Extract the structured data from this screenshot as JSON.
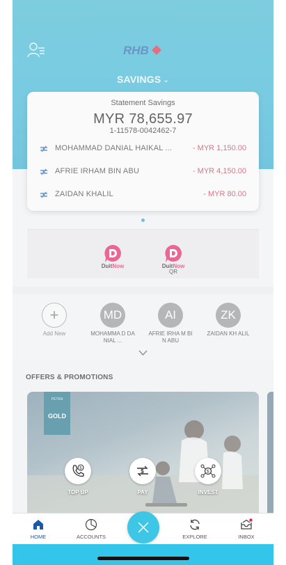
{
  "header": {
    "logo_text": "RHB",
    "account_switch_label": "SAVINGS"
  },
  "account_card": {
    "type": "Statement Savings",
    "balance": "MYR 78,655.97",
    "number": "1-11578-0042462-7",
    "transactions": [
      {
        "name": "MOHAMMAD DANIAL HAIKAL ...",
        "amount": "- MYR 1,150.00"
      },
      {
        "name": "AFRIE IRHAM BIN ABU",
        "amount": "- MYR 4,150.00"
      },
      {
        "name": "ZAIDAN KHALIL",
        "amount": "- MYR 80.00"
      }
    ]
  },
  "duitnow": {
    "items": [
      {
        "brand_a": "Duit",
        "brand_b": "Now",
        "sub": ""
      },
      {
        "brand_a": "Duit",
        "brand_b": "Now",
        "sub": "QR"
      }
    ]
  },
  "favourites": {
    "add_label": "Add New",
    "contacts": [
      {
        "initials": "MD",
        "label": "MOHAMMA D DANIAL ..."
      },
      {
        "initials": "AI",
        "label": "AFRIE IRHA M BIN ABU"
      },
      {
        "initials": "ZK",
        "label": "ZAIDAN KH ALIL"
      }
    ]
  },
  "offers": {
    "title": "OFFERS & PROMOTIONS",
    "badge_top": "PETRA",
    "badge_main": "GOLD"
  },
  "quick_actions": [
    {
      "label": "TOP UP",
      "icon": "phone-dollar-icon"
    },
    {
      "label": "PAY",
      "icon": "transfer-dollar-icon"
    },
    {
      "label": "INVEST",
      "icon": "network-dollar-icon"
    }
  ],
  "bottom_nav": [
    {
      "label": "HOME",
      "icon": "home-icon",
      "active": true
    },
    {
      "label": "ACCOUNTS",
      "icon": "pie-chart-icon",
      "active": false
    },
    {
      "label": "EXPLORE",
      "icon": "refresh-icon",
      "active": false
    },
    {
      "label": "INBOX",
      "icon": "inbox-icon",
      "active": false
    }
  ],
  "colors": {
    "hero": "#34b1d3",
    "accent_red": "#c0304a",
    "duitnow_pink": "#e2185b",
    "fab": "#3ec6e6",
    "nav_active": "#1a5aa8"
  }
}
